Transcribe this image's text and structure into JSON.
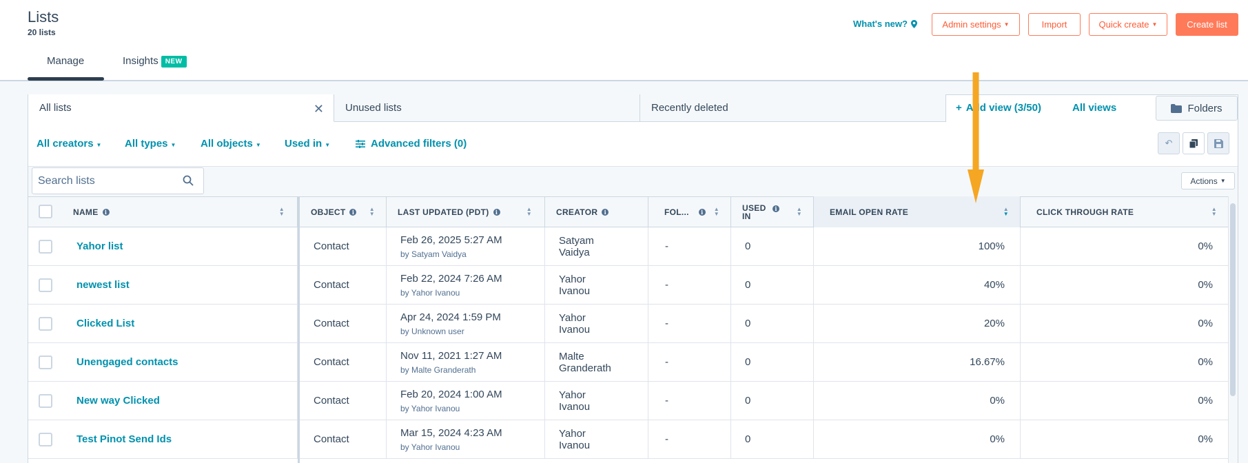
{
  "header": {
    "title": "Lists",
    "subtitle": "20 lists",
    "whats_new": "What's new?",
    "admin_settings": "Admin settings",
    "import": "Import",
    "quick_create": "Quick create",
    "create_list": "Create list"
  },
  "tabs": [
    {
      "label": "Manage",
      "active": true
    },
    {
      "label": "Insights",
      "badge": "NEW"
    }
  ],
  "views": {
    "tabs": [
      "All lists",
      "Unused lists",
      "Recently deleted"
    ],
    "add_view": "Add view (3/50)",
    "all_views": "All views",
    "folders": "Folders"
  },
  "filters": {
    "creators": "All creators",
    "types": "All types",
    "objects": "All objects",
    "used_in": "Used in",
    "advanced": "Advanced filters (0)"
  },
  "search": {
    "placeholder": "Search lists"
  },
  "actions": "Actions",
  "columns": [
    "NAME",
    "OBJECT",
    "LAST UPDATED (PDT)",
    "CREATOR",
    "FOL...",
    "USED IN",
    "EMAIL OPEN RATE",
    "CLICK THROUGH RATE"
  ],
  "rows": [
    {
      "name": "Yahor list",
      "object": "Contact",
      "updated": "Feb 26, 2025 5:27 AM",
      "by": "by Satyam Vaidya",
      "creator": "Satyam Vaidya",
      "folder": "-",
      "used_in": "0",
      "open_rate": "100%",
      "ctr": "0%"
    },
    {
      "name": "newest list",
      "object": "Contact",
      "updated": "Feb 22, 2024 7:26 AM",
      "by": "by Yahor Ivanou",
      "creator": "Yahor Ivanou",
      "folder": "-",
      "used_in": "0",
      "open_rate": "40%",
      "ctr": "0%"
    },
    {
      "name": "Clicked List",
      "object": "Contact",
      "updated": "Apr 24, 2024 1:59 PM",
      "by": "by Unknown user",
      "creator": "Yahor Ivanou",
      "folder": "-",
      "used_in": "0",
      "open_rate": "20%",
      "ctr": "0%"
    },
    {
      "name": "Unengaged contacts",
      "object": "Contact",
      "updated": "Nov 11, 2021 1:27 AM",
      "by": "by Malte Granderath",
      "creator": "Malte Granderath",
      "folder": "-",
      "used_in": "0",
      "open_rate": "16.67%",
      "ctr": "0%"
    },
    {
      "name": "New way Clicked",
      "object": "Contact",
      "updated": "Feb 20, 2024 1:00 AM",
      "by": "by Yahor Ivanou",
      "creator": "Yahor Ivanou",
      "folder": "-",
      "used_in": "0",
      "open_rate": "0%",
      "ctr": "0%"
    },
    {
      "name": "Test Pinot Send Ids",
      "object": "Contact",
      "updated": "Mar 15, 2024 4:23 AM",
      "by": "by Yahor Ivanou",
      "creator": "Yahor Ivanou",
      "folder": "-",
      "used_in": "0",
      "open_rate": "0%",
      "ctr": "0%"
    }
  ],
  "colors": {
    "accent": "#ff7a59",
    "link": "#0091ae",
    "text": "#33475b",
    "annotation": "#f5a623",
    "badge": "#00bda5"
  },
  "icons": [
    "location-pin-icon",
    "close-icon",
    "plus-icon",
    "folder-icon",
    "filter-sliders-icon",
    "undo-icon",
    "copy-icon",
    "save-icon",
    "search-icon",
    "info-icon",
    "sort-icon",
    "down-arrow-annotation"
  ]
}
